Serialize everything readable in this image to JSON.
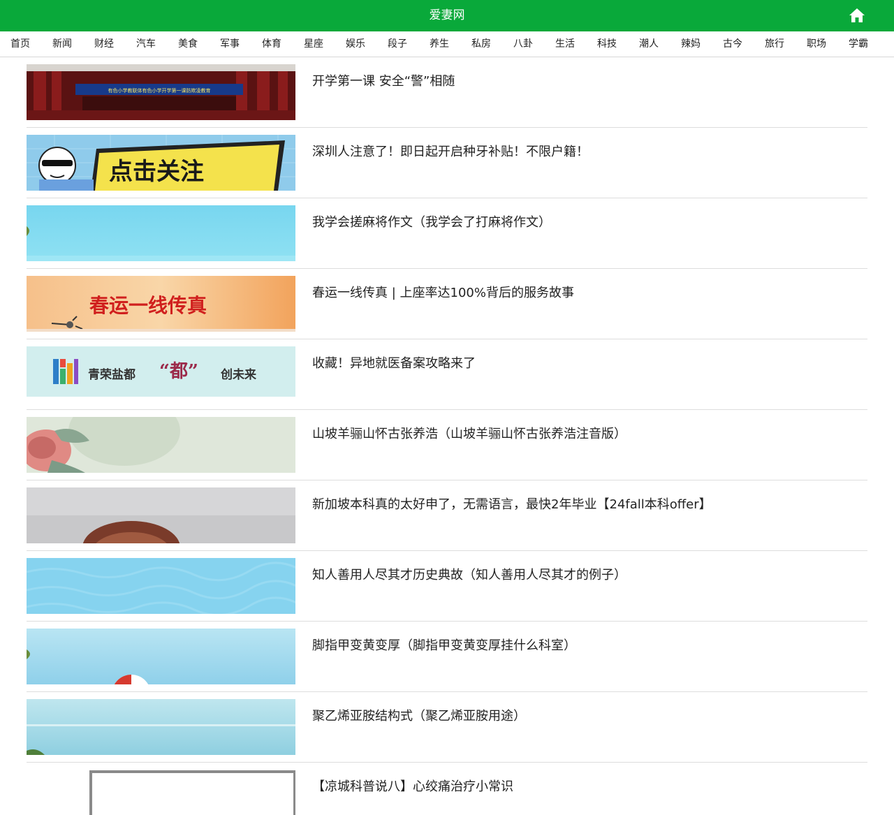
{
  "header": {
    "title": "爱妻网",
    "home_icon": "home-icon"
  },
  "nav": {
    "items": [
      {
        "label": "首页"
      },
      {
        "label": "新闻"
      },
      {
        "label": "财经"
      },
      {
        "label": "汽车"
      },
      {
        "label": "美食"
      },
      {
        "label": "军事"
      },
      {
        "label": "体育"
      },
      {
        "label": "星座"
      },
      {
        "label": "娱乐"
      },
      {
        "label": "段子"
      },
      {
        "label": "养生"
      },
      {
        "label": "私房"
      },
      {
        "label": "八卦"
      },
      {
        "label": "生活"
      },
      {
        "label": "科技"
      },
      {
        "label": "潮人"
      },
      {
        "label": "辣妈"
      },
      {
        "label": "古今"
      },
      {
        "label": "旅行"
      },
      {
        "label": "职场"
      },
      {
        "label": "学霸"
      }
    ]
  },
  "articles": [
    {
      "title": "开学第一课 安全“警”相随",
      "thumb_banner": "有色小学教联体有色小学开学第一课防欺凌教育"
    },
    {
      "title": "深圳人注意了！即日起开启种牙补贴！不限户籍！",
      "thumb_text": "点击关注"
    },
    {
      "title": "我学会搓麻将作文（我学会了打麻将作文）"
    },
    {
      "title": "春运一线传真 | 上座率达100%背后的服务故事",
      "thumb_text": "春运一线传真"
    },
    {
      "title": "收藏！异地就医备案攻略来了",
      "thumb_text_left": "青荣盐都",
      "thumb_text_mid": "“都”",
      "thumb_text_right": "创未来"
    },
    {
      "title": "山坡羊骊山怀古张养浩（山坡羊骊山怀古张养浩注音版）"
    },
    {
      "title": "新加坡本科真的太好申了，无需语言，最快2年毕业【24fall本科offer】"
    },
    {
      "title": "知人善用人尽其才历史典故（知人善用人尽其才的例子）"
    },
    {
      "title": "脚指甲变黄变厚（脚指甲变黄变厚挂什么科室）"
    },
    {
      "title": "聚乙烯亚胺结构式（聚乙烯亚胺用途）"
    },
    {
      "title": "【凉城科普说八】心绞痛治疗小常识"
    }
  ],
  "colors": {
    "header_bg": "#09a93a",
    "divider": "#dddddd"
  }
}
